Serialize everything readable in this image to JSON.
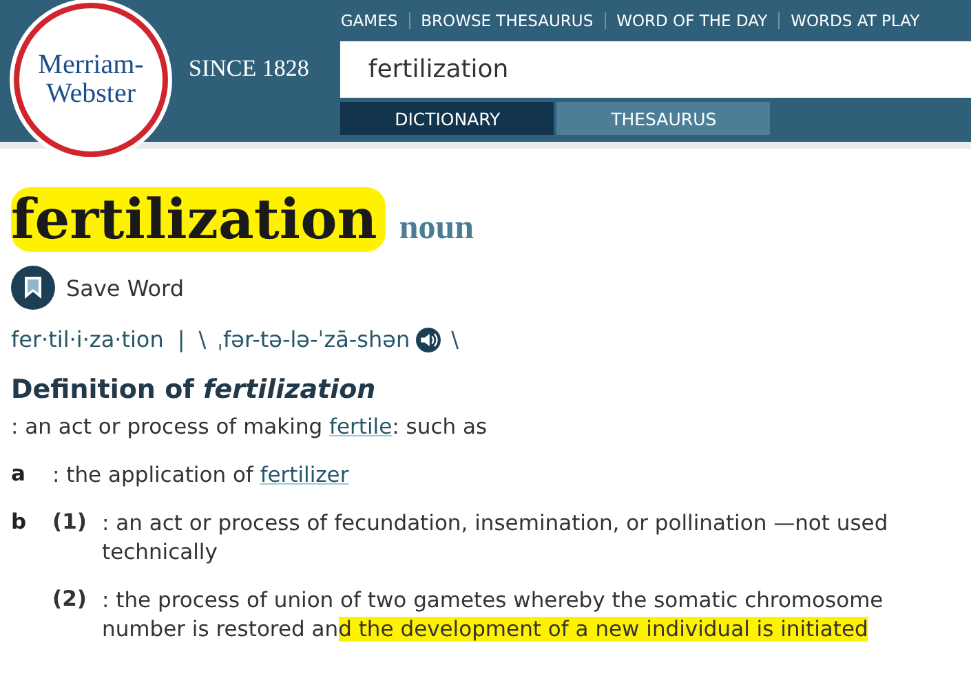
{
  "header": {
    "logo": [
      "Merriam-",
      "Webster"
    ],
    "since": "SINCE 1828",
    "nav": [
      "GAMES",
      "BROWSE THESAURUS",
      "WORD OF THE DAY",
      "WORDS AT PLAY"
    ],
    "search": {
      "value": "fertilization"
    },
    "tabs": [
      {
        "label": "DICTIONARY",
        "selected": true
      },
      {
        "label": "THESAURUS",
        "selected": false
      }
    ]
  },
  "entry": {
    "headword": "fertilization",
    "highlighted": true,
    "part_of_speech": "noun",
    "save": "Save Word",
    "syllables": "fer·til·i·za·tion",
    "separator": "|",
    "pron_open": "\\",
    "pronunciation": "ˌfər-tə-lə-ˈzā-shən",
    "pron_close": "\\",
    "definition_heading": "Definition of *fertilization*",
    "intro": [
      {
        "kind": "text",
        "text": ": an act or process of making ",
        "highlighted": false
      },
      {
        "kind": "link",
        "text": "fertile",
        "highlighted": false
      },
      {
        "kind": "text",
        "text": ": such as",
        "highlighted": false
      }
    ],
    "senses": [
      {
        "letter": "a",
        "parts": [
          {
            "kind": "text",
            "text": ": the application of ",
            "highlighted": false
          },
          {
            "kind": "link",
            "text": "fertilizer",
            "highlighted": false
          }
        ]
      },
      {
        "letter": "b",
        "number": "(1)",
        "parts": [
          {
            "kind": "text",
            "text": ": an act or process of fecundation, insemination, or pollination —not used technically",
            "highlighted": false
          }
        ]
      },
      {
        "number": "(2)",
        "parts": [
          {
            "kind": "text",
            "text": ": the process of union of two gametes whereby the somatic chromosome number is restored an",
            "highlighted": false
          },
          {
            "kind": "text",
            "text": "d the development of a new individual is initiated",
            "highlighted": true
          }
        ]
      }
    ]
  }
}
